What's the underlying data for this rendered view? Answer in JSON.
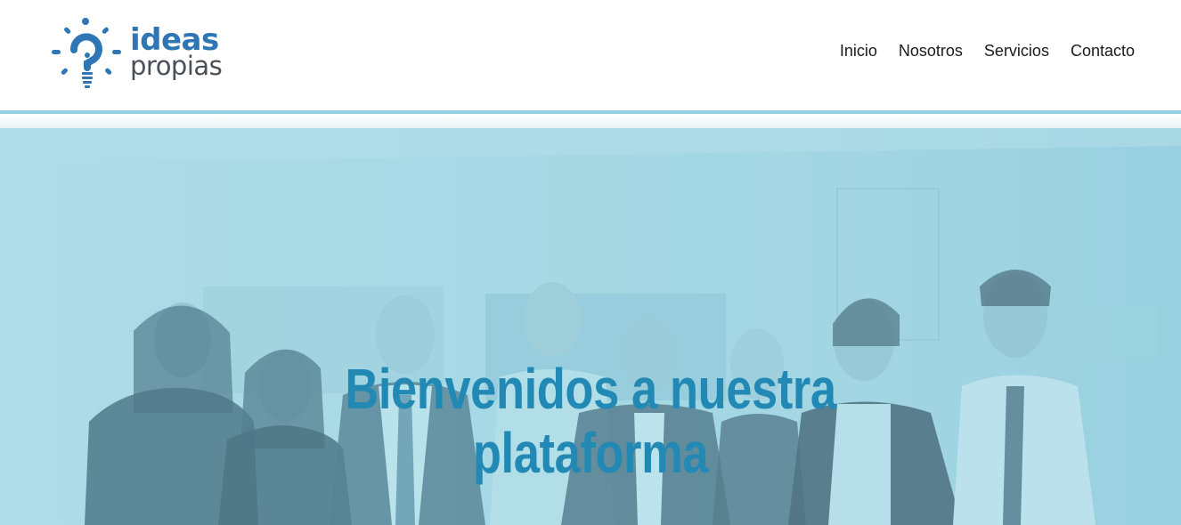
{
  "brand": {
    "logo_line1": "ideas",
    "logo_line2": "propias",
    "logo_icon": "lightbulb-question-icon",
    "primary_color": "#2f76b4",
    "secondary_color": "#4a5057"
  },
  "nav": {
    "items": [
      {
        "label": "Inicio"
      },
      {
        "label": "Nosotros"
      },
      {
        "label": "Servicios"
      },
      {
        "label": "Contacto"
      }
    ]
  },
  "hero": {
    "title_line1": "Bienvenidos a nuestra",
    "title_line2": "plataforma",
    "title_color": "#2189b4",
    "overlay_color": "#a6d9e6",
    "background": "team-group-photo"
  },
  "colors": {
    "divider": "#8fd0e4"
  }
}
